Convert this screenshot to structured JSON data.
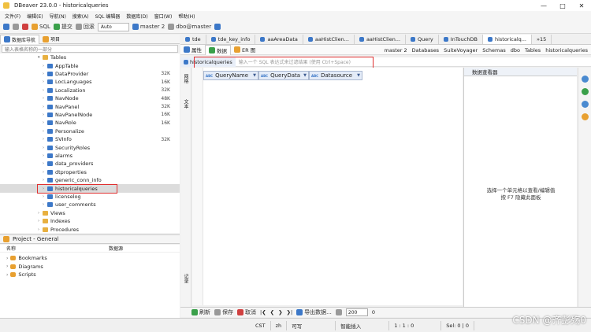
{
  "window": {
    "title": "DBeaver 23.0.0 - historicalqueries"
  },
  "menu": [
    "文件(F)",
    "编辑(E)",
    "导航(N)",
    "搜索(A)",
    "SQL 编辑器",
    "数据库(D)",
    "窗口(W)",
    "帮助(H)"
  ],
  "toolbar": {
    "sql_label": "SQL",
    "commit_label": "提交",
    "rollback_label": "回滚",
    "mode_value": "Auto",
    "connection": "master 2",
    "schema": "dbo@master"
  },
  "left_panel": {
    "tab_navigator": "数据库导航",
    "tab_projects": "项目",
    "filter_placeholder": "输入表格名称的一部分",
    "tree": [
      {
        "label": "Tables",
        "type": "folder",
        "indent": 0,
        "expanded": true,
        "size": ""
      },
      {
        "label": "AppTable",
        "type": "table",
        "indent": 1,
        "size": ""
      },
      {
        "label": "DataProvider",
        "type": "table",
        "indent": 1,
        "size": "32K"
      },
      {
        "label": "LocLanguages",
        "type": "table",
        "indent": 1,
        "size": "16K"
      },
      {
        "label": "Localization",
        "type": "table",
        "indent": 1,
        "size": "32K"
      },
      {
        "label": "NavNode",
        "type": "table",
        "indent": 1,
        "size": "48K"
      },
      {
        "label": "NavPanel",
        "type": "table",
        "indent": 1,
        "size": "32K"
      },
      {
        "label": "NavPanelNode",
        "type": "table",
        "indent": 1,
        "size": "16K"
      },
      {
        "label": "NavRole",
        "type": "table",
        "indent": 1,
        "size": "16K"
      },
      {
        "label": "Personalize",
        "type": "table",
        "indent": 1,
        "size": ""
      },
      {
        "label": "SVInfo",
        "type": "table",
        "indent": 1,
        "size": "32K"
      },
      {
        "label": "SecurityRoles",
        "type": "table",
        "indent": 1,
        "size": ""
      },
      {
        "label": "alarms",
        "type": "table",
        "indent": 1,
        "size": ""
      },
      {
        "label": "data_providers",
        "type": "table",
        "indent": 1,
        "size": ""
      },
      {
        "label": "dtproperties",
        "type": "table",
        "indent": 1,
        "size": ""
      },
      {
        "label": "generic_conn_info",
        "type": "table",
        "indent": 1,
        "size": ""
      },
      {
        "label": "historicalqueries",
        "type": "table",
        "indent": 1,
        "size": "",
        "selected": true
      },
      {
        "label": "licenselog",
        "type": "table",
        "indent": 1,
        "size": ""
      },
      {
        "label": "user_comments",
        "type": "table",
        "indent": 1,
        "size": ""
      },
      {
        "label": "Views",
        "type": "folder",
        "indent": 0,
        "size": ""
      },
      {
        "label": "Indexes",
        "type": "folder",
        "indent": 0,
        "size": ""
      },
      {
        "label": "Procedures",
        "type": "folder",
        "indent": 0,
        "size": ""
      }
    ]
  },
  "project_panel": {
    "title": "Project - General",
    "col_name": "名称",
    "col_source": "数据源",
    "items": [
      "Bookmarks",
      "Diagrams",
      "Scripts"
    ]
  },
  "editor_tabs": [
    "tde",
    "tde_key_info",
    "aaAreaData",
    "aaHistClien...",
    "aaHistClien...",
    "Query",
    "InTouchDB",
    "historicalq..."
  ],
  "editor_tabs_overflow": "»15",
  "sub_tabs": [
    "属性",
    "数据",
    "ER 图"
  ],
  "crumbs": [
    "master 2",
    "Databases",
    "SuiteVoyager",
    "Schemas",
    "dbo",
    "Tables",
    "historicalqueries"
  ],
  "query": {
    "table": "historicalqueries",
    "hint": "输入一个 SQL 表达式来过滤结果 (使用 Ctrl+Space)"
  },
  "grid": {
    "columns": [
      "QueryName",
      "QueryData",
      "Datasource"
    ],
    "type_tag": "ABC"
  },
  "side_labels": [
    "网格",
    "文本",
    "记录"
  ],
  "viewer": {
    "title": "数据查看器",
    "hint_line1": "选择一个单元格以查看/编辑值",
    "hint_line2": "按 F7 隐藏此面板"
  },
  "bottom": {
    "refresh": "刷新",
    "save": "保存",
    "cancel": "取消",
    "export": "导出数据...",
    "fetch_size": "200",
    "count": "0"
  },
  "status": {
    "tz": "CST",
    "locale": "zh",
    "writable": "可写",
    "insert_mode": "智能插入",
    "position": "1 : 1 : 0",
    "selection": "Sel: 0 | 0"
  },
  "watermark": "CSDN @齐彭殇0"
}
